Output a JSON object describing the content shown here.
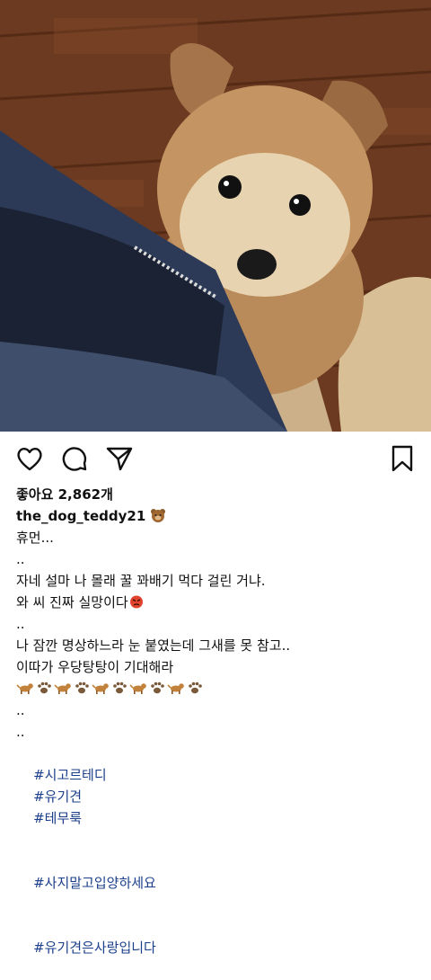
{
  "post": {
    "image_alt": "puppy",
    "likes": "좋아요 2,862개",
    "username": "the_dog_teddy21",
    "username_emoji": "bear-face-icon",
    "caption_lines": [
      "휴먼...",
      "..",
      "자네 설마 나 몰래 꿀 꽈배기 먹다 걸린 거냐.",
      "와 씨 진짜 실망이다",
      "..",
      "나 잠깐 명상하느라 눈 붙였는데 그새를 못 참고..",
      "이따가 우당탕탕이 기대해라",
      "",
      "..",
      ".."
    ],
    "angry_emoji": "angry-face-icon",
    "emoji_row": [
      "dog-icon",
      "paw-icon",
      "dog-icon",
      "paw-icon",
      "dog-icon",
      "paw-icon",
      "dog-icon",
      "paw-icon",
      "dog-icon",
      "paw-icon"
    ],
    "hashtags_line1": [
      "#시고르테디",
      "#유기견",
      "#테무룩"
    ],
    "hashtags_line2": "#사지말고입양하세요",
    "hashtags_line3": "#유기견은사랑입니다"
  },
  "actions": {
    "like": "heart-icon",
    "comment": "comment-icon",
    "share": "send-icon",
    "save": "bookmark-icon"
  }
}
